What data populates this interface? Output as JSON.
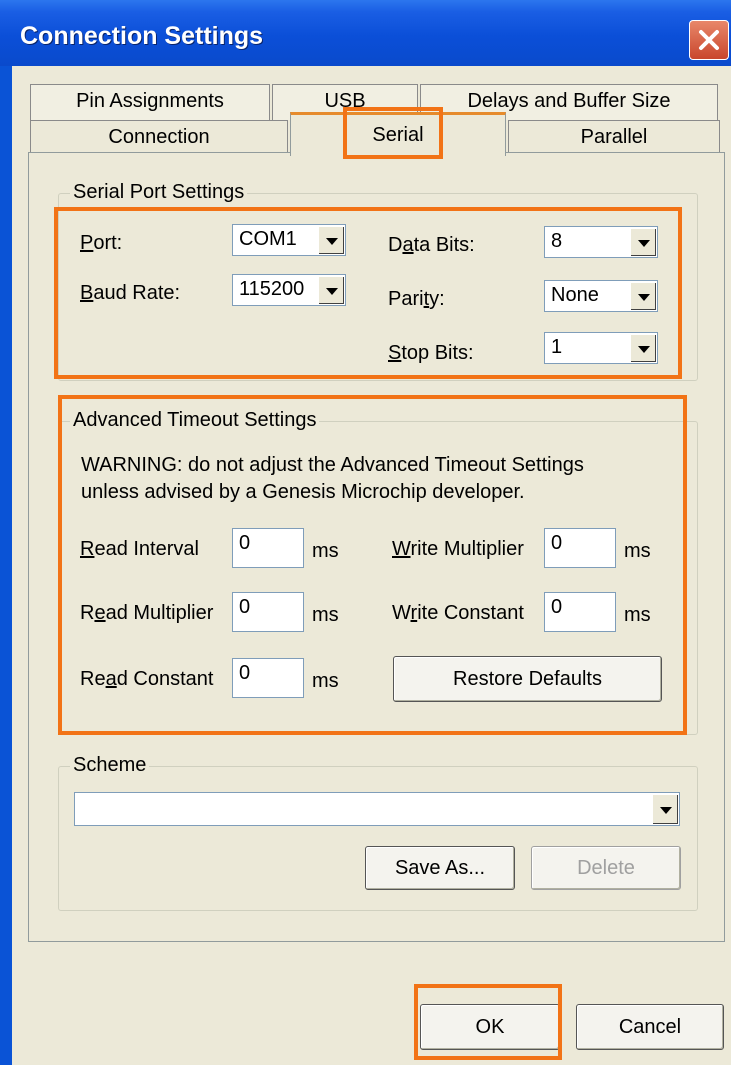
{
  "window": {
    "title": "Connection Settings"
  },
  "tabs": {
    "back_row": [
      "Pin Assignments",
      "USB",
      "Delays and Buffer Size"
    ],
    "front_row": [
      "Connection",
      "Serial",
      "Parallel"
    ],
    "active": "Serial"
  },
  "serial": {
    "group_title": "Serial Port Settings",
    "port": {
      "label": "Port:",
      "value": "COM1"
    },
    "baud": {
      "label": "Baud Rate:",
      "value": "115200"
    },
    "data_bits": {
      "label": "Data Bits:",
      "value": "8"
    },
    "parity": {
      "label": "Parity:",
      "value": "None"
    },
    "stop_bits": {
      "label": "Stop Bits:",
      "value": "1"
    }
  },
  "timeout": {
    "group_title": "Advanced Timeout Settings",
    "warning_line1": "WARNING: do not adjust the Advanced Timeout Settings",
    "warning_line2": "unless advised by a Genesis Microchip developer.",
    "read_interval": {
      "label": "Read Interval",
      "value": "0"
    },
    "read_multiplier": {
      "label": "Read Multiplier",
      "value": "0"
    },
    "read_constant": {
      "label": "Read Constant",
      "value": "0"
    },
    "write_multiplier": {
      "label": "Write Multiplier",
      "value": "0"
    },
    "write_constant": {
      "label": "Write Constant",
      "value": "0"
    },
    "unit": "ms",
    "restore_label": "Restore Defaults"
  },
  "scheme": {
    "group_title": "Scheme",
    "value": "",
    "save_as_label": "Save As...",
    "delete_label": "Delete"
  },
  "footer": {
    "ok_label": "OK",
    "cancel_label": "Cancel"
  },
  "colors": {
    "highlight": "#F27316",
    "titlebar": "#0A53D6",
    "dialog_bg": "#ECE9D8"
  }
}
